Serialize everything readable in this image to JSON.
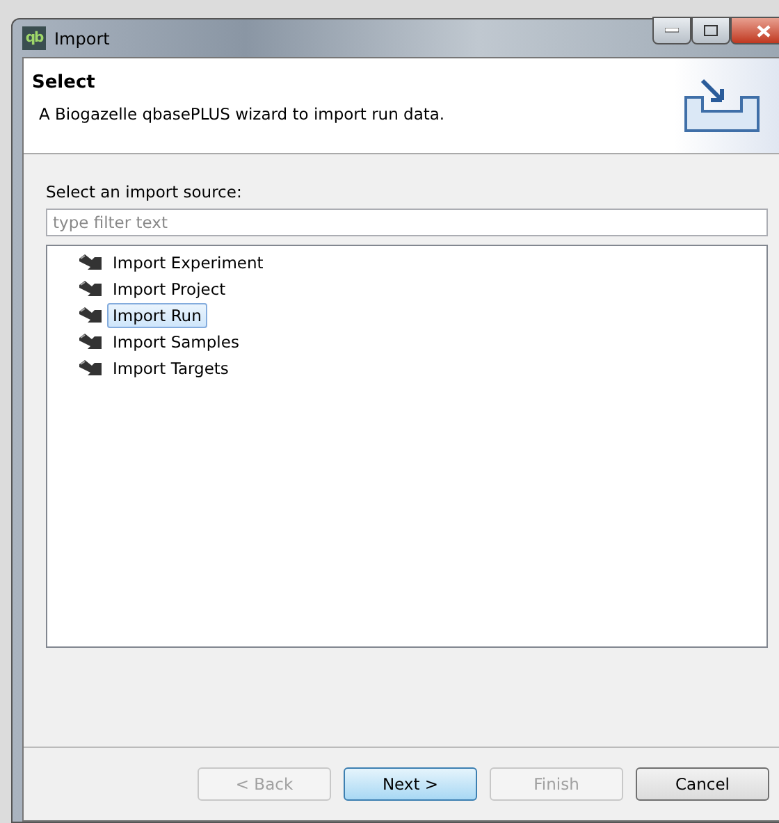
{
  "window": {
    "icon_text": "qb",
    "title": "Import"
  },
  "header": {
    "title": "Select",
    "description": "A Biogazelle qbasePLUS wizard to import run data."
  },
  "source": {
    "label": "Select an import source:",
    "filter": {
      "placeholder": "type filter text"
    },
    "items": [
      {
        "label": "Import Experiment",
        "selected": false
      },
      {
        "label": "Import Project",
        "selected": false
      },
      {
        "label": "Import Run",
        "selected": true
      },
      {
        "label": "Import Samples",
        "selected": false
      },
      {
        "label": "Import Targets",
        "selected": false
      }
    ]
  },
  "buttons": [
    {
      "label": "< Back",
      "disabled": true,
      "default": false
    },
    {
      "label": "Next >",
      "disabled": false,
      "default": true
    },
    {
      "label": "Finish",
      "disabled": true,
      "default": false
    },
    {
      "label": "Cancel",
      "disabled": false,
      "default": false
    }
  ]
}
